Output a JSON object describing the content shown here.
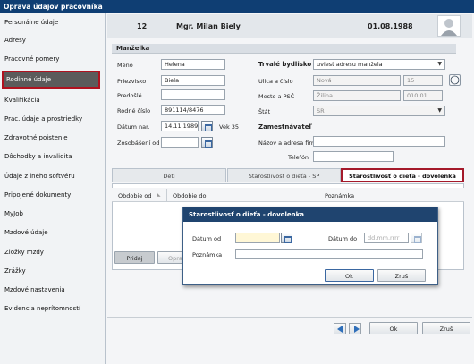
{
  "window": {
    "title": "Oprava údajov pracovníka"
  },
  "sidebar": {
    "items": [
      {
        "label": "Personálne údaje"
      },
      {
        "label": "Adresy"
      },
      {
        "label": "Pracovné pomery"
      },
      {
        "label": "Rodinné údaje",
        "active": true
      },
      {
        "label": "Kvalifikácia"
      },
      {
        "label": "Prac. údaje a prostriedky"
      },
      {
        "label": "Zdravotné poistenie"
      },
      {
        "label": "Dôchodky a invalidita"
      },
      {
        "label": "Údaje z iného softvéru"
      },
      {
        "label": "Pripojené dokumenty"
      },
      {
        "label": "MyJob"
      },
      {
        "label": "Mzdové údaje"
      },
      {
        "label": "Zložky mzdy"
      },
      {
        "label": "Zrážky"
      },
      {
        "label": "Mzdové nastavenia"
      },
      {
        "label": "Evidencia neprítomností"
      }
    ]
  },
  "header": {
    "number": "12",
    "name": "Mgr. Milan Biely",
    "date": "01.08.1988"
  },
  "spouse": {
    "section_title": "Manželka",
    "meno_label": "Meno",
    "meno": "Helena",
    "priezvisko_label": "Priezvisko",
    "priezvisko": "Biela",
    "predosle_label": "Predošlé",
    "predosle": "",
    "rodne_cislo_label": "Rodné číslo",
    "rodne_cislo": "891114/8476",
    "datum_nar_label": "Dátum nar.",
    "datum_nar": "14.11.1989",
    "vek": "Vek 35",
    "zosobasenie_label": "Zosobášení od",
    "zosobasenie": ""
  },
  "address": {
    "title": "Trvalé bydlisko",
    "select_value": "uviesť adresu manžela",
    "ulica_label": "Ulica a číslo",
    "ulica": "Nová",
    "cislo": "15",
    "mesto_label": "Mesto a PSČ",
    "mesto": "Žilina",
    "psc": "010 01",
    "stat_label": "Štát",
    "stat": "SR"
  },
  "employer": {
    "title": "Zamestnávateľ",
    "firma_label": "Názov a adresa firmy",
    "firma": "",
    "telefon_label": "Telefón",
    "telefon": ""
  },
  "tabs": [
    {
      "label": "Deti"
    },
    {
      "label": "Starostlivosť o dieťa - SP"
    },
    {
      "label": "Starostlivosť o dieťa - dovolenka",
      "active": true
    }
  ],
  "table": {
    "columns": [
      "Obdobie od",
      "Obdobie do",
      "Poznámka"
    ]
  },
  "table_buttons": {
    "add": "Pridaj",
    "edit": "Opra"
  },
  "dialog": {
    "title": "Starostlivosť o dieťa - dovolenka",
    "datum_od_label": "Dátum od",
    "datum_od": "",
    "datum_do_label": "Dátum do",
    "datum_do_placeholder": "dd.mm.rrrr",
    "poznamka_label": "Poznámka",
    "poznamka": "",
    "ok": "Ok",
    "cancel": "Zruš"
  },
  "footer": {
    "ok": "Ok",
    "cancel": "Zruš"
  },
  "colors": {
    "titlebar": "#0f3e73",
    "active_border": "#b0121f",
    "dialog_title": "#1f446f"
  }
}
